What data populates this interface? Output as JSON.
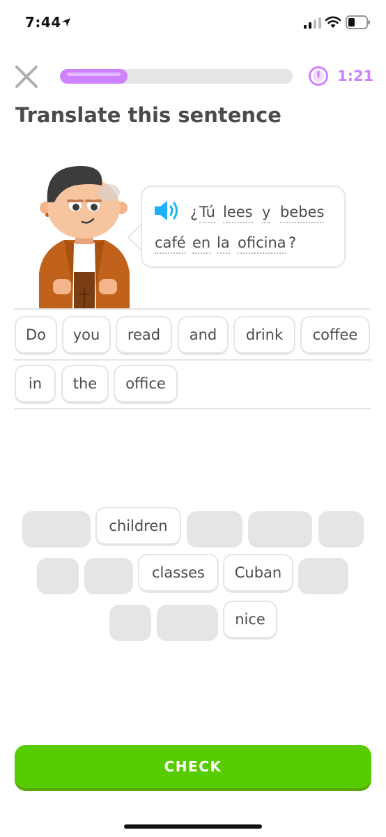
{
  "status_bar": {
    "time": "7:44"
  },
  "header": {
    "timer": "1:21",
    "progress_fraction": 0.29
  },
  "prompt": {
    "title": "Translate this sentence",
    "sentence_line1": [
      {
        "text": "¿",
        "hint": false
      },
      {
        "text": "Tú",
        "hint": true
      },
      {
        "text": "lees",
        "hint": true
      },
      {
        "text": "y",
        "hint": true
      },
      {
        "text": "bebes",
        "hint": true
      }
    ],
    "sentence_line2": [
      {
        "text": "café",
        "hint": true
      },
      {
        "text": "en",
        "hint": true
      },
      {
        "text": "la",
        "hint": true
      },
      {
        "text": "oficina",
        "hint": true
      },
      {
        "text": "?",
        "hint": false
      }
    ]
  },
  "answer": {
    "row1": [
      "Do",
      "you",
      "read",
      "and",
      "drink",
      "coffee"
    ],
    "row2": [
      "in",
      "the",
      "office"
    ]
  },
  "word_bank": {
    "row1": [
      {
        "text": "",
        "used": true
      },
      {
        "text": "children",
        "used": false
      },
      {
        "text": "",
        "used": true
      },
      {
        "text": "",
        "used": true
      },
      {
        "text": "",
        "used": true
      }
    ],
    "row2": [
      {
        "text": "",
        "used": true
      },
      {
        "text": "",
        "used": true
      },
      {
        "text": "classes",
        "used": false
      },
      {
        "text": "Cuban",
        "used": false
      },
      {
        "text": "",
        "used": true
      }
    ],
    "row3": [
      {
        "text": "",
        "used": true
      },
      {
        "text": "",
        "used": true
      },
      {
        "text": "nice",
        "used": false
      }
    ]
  },
  "check_button": {
    "label": "CHECK"
  },
  "colors": {
    "accent_purple": "#ce82ff",
    "check_green": "#58cc02",
    "check_green_shadow": "#58a700",
    "speaker_blue": "#1cb0f6",
    "border_gray": "#e5e5e5"
  }
}
